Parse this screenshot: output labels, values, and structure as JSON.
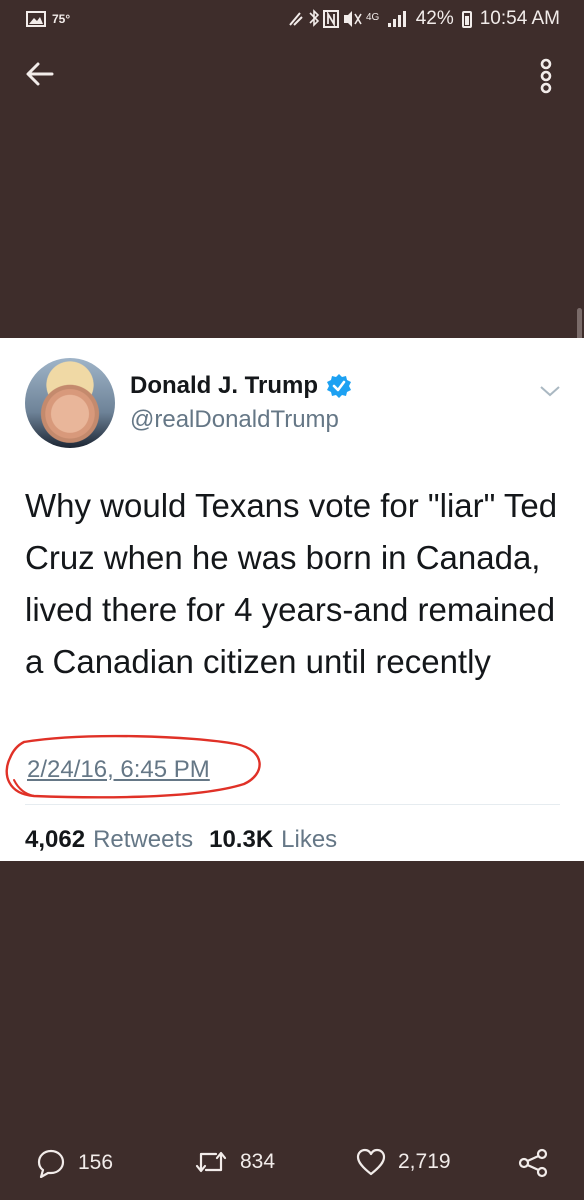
{
  "status_bar": {
    "temperature": "75°",
    "network": "4G",
    "battery": "42%",
    "time": "10:54 AM"
  },
  "tweet": {
    "display_name": "Donald J. Trump",
    "handle": "@realDonaldTrump",
    "text": "Why would Texans vote for \"liar\" Ted Cruz when he was born in Canada, lived there for 4 years-and remained a Canadian citizen until recently",
    "timestamp": "2/24/16, 6:45 PM",
    "retweets_count": "4,062",
    "retweets_label": "Retweets",
    "likes_count": "10.3K",
    "likes_label": "Likes"
  },
  "actions": {
    "replies": "156",
    "retweets": "834",
    "likes": "2,719"
  },
  "colors": {
    "background": "#3e2d2b",
    "card": "#ffffff",
    "secondary_text": "#657786",
    "verified": "#1da1f2",
    "annotation": "#e03127"
  },
  "icons": [
    "picture-icon",
    "back-arrow-icon",
    "overflow-menu-icon",
    "verified-badge-icon",
    "chevron-down-icon",
    "reply-icon",
    "retweet-icon",
    "like-icon",
    "share-icon"
  ]
}
